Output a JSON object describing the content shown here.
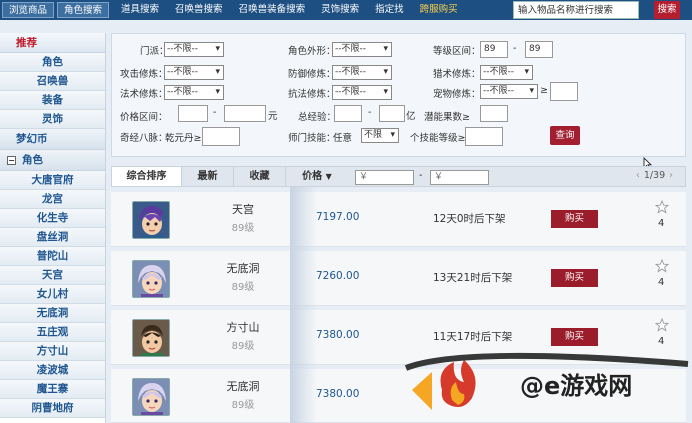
{
  "topnav": {
    "tabs": [
      {
        "label": "浏览商品",
        "style": "active"
      },
      {
        "label": "角色搜索",
        "style": "active"
      },
      {
        "label": "道具搜索",
        "style": "plain"
      },
      {
        "label": "召唤兽搜索",
        "style": "plain"
      },
      {
        "label": "召唤兽装备搜索",
        "style": "plain"
      },
      {
        "label": "灵饰搜索",
        "style": "plain"
      },
      {
        "label": "指定找",
        "style": "plain"
      },
      {
        "label": "跨服购买",
        "style": "gold"
      }
    ],
    "search_placeholder": "输入物品名称进行搜索",
    "search_button": "搜索"
  },
  "sidebar": {
    "recommend": "推荐",
    "recommend_items": [
      "角色",
      "召唤兽",
      "装备",
      "灵饰"
    ],
    "currency": "梦幻币",
    "role_category": "角色",
    "collapse_glyph": "−",
    "schools": [
      "大唐官府",
      "龙宫",
      "化生寺",
      "盘丝洞",
      "普陀山",
      "天宫",
      "女儿村",
      "无底洞",
      "五庄观",
      "方寸山",
      "凌波城",
      "魔王寨",
      "阴曹地府"
    ]
  },
  "filters": {
    "school_label": "门派：",
    "appearance_label": "角色外形：",
    "level_label": "等级区间：",
    "level_min": "89",
    "level_max": "89",
    "dash": "-",
    "attack_label": "攻击修炼：",
    "defense_label": "防御修炼：",
    "hunt_label": "猎术修炼：",
    "magic_label": "法术修炼：",
    "resist_label": "抗法修炼：",
    "pet_label": "宠物修炼：",
    "ge_symbol": "≥",
    "price_label": "价格区间：",
    "price_unit": "元",
    "exp_label": "总经验：",
    "exp_unit": "亿",
    "potential_label": "潜能果数≥",
    "qimai_label": "奇经八脉：",
    "qimai_value": "乾元丹≥",
    "skill_label": "师门技能：",
    "skill_any": "任意",
    "skill_count_label": "个技能等级≥",
    "unlimited": "--不限--",
    "unlimited_short": "不限",
    "query_button": "查询"
  },
  "sortbar": {
    "tabs": [
      "综合排序",
      "最新",
      "收藏",
      "价格"
    ],
    "price_arrow": "▼",
    "currency_symbol": "￥",
    "dash": "-",
    "prev": "‹",
    "page": "1/39",
    "next": "›"
  },
  "listings": [
    {
      "school": "天宫",
      "level": "89级",
      "price": "7197.00",
      "time": "12天0时后下架",
      "buy": "购买",
      "favorites": "4"
    },
    {
      "school": "无底洞",
      "level": "89级",
      "price": "7260.00",
      "time": "13天21时后下架",
      "buy": "购买",
      "favorites": "4"
    },
    {
      "school": "方寸山",
      "level": "89级",
      "price": "7380.00",
      "time": "11天17时后下架",
      "buy": "购买",
      "favorites": "4"
    },
    {
      "school": "无底洞",
      "level": "89级",
      "price": "7380.00",
      "time": "",
      "buy": "",
      "favorites": ""
    }
  ],
  "watermark": {
    "text": "@e游戏网"
  },
  "colors": {
    "nav_bg": "#1d4f82",
    "accent_red": "#9b1d2b",
    "link_blue": "#1f5690"
  }
}
